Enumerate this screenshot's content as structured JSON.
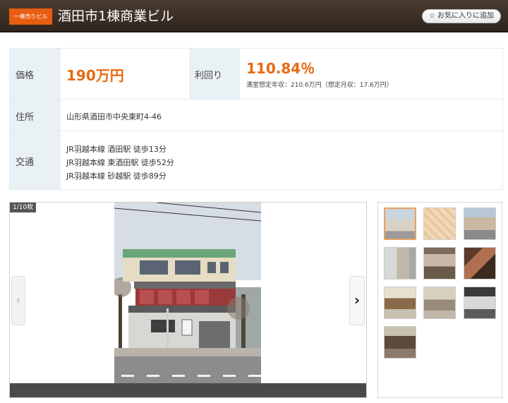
{
  "header": {
    "badge": "一棟売りビル",
    "title": "酒田市1棟商業ビル",
    "favorite_label": "お気に入りに追加"
  },
  "info": {
    "price_label": "価格",
    "price_value": "190万円",
    "yield_label": "利回り",
    "yield_value": "110.84％",
    "yield_detail": "満室想定年収：210.6万円（想定月収：17.6万円）",
    "address_label": "住所",
    "address_value": "山形県酒田市中央東町4-46",
    "transit_label": "交通",
    "transit_lines": [
      "JR羽越本線 酒田駅 徒歩13分",
      "JR羽越本線 東酒田駅 徒歩52分",
      "JR羽越本線 砂越駅 徒歩89分"
    ]
  },
  "gallery": {
    "counter": "1/10枚",
    "prev_icon": "chevron-left-icon",
    "next_icon": "chevron-right-icon",
    "thumbnail_count": 10
  },
  "colors": {
    "accent": "#e86a12",
    "header_bg": "#3a2e24",
    "label_bg": "#e9f1f5"
  }
}
